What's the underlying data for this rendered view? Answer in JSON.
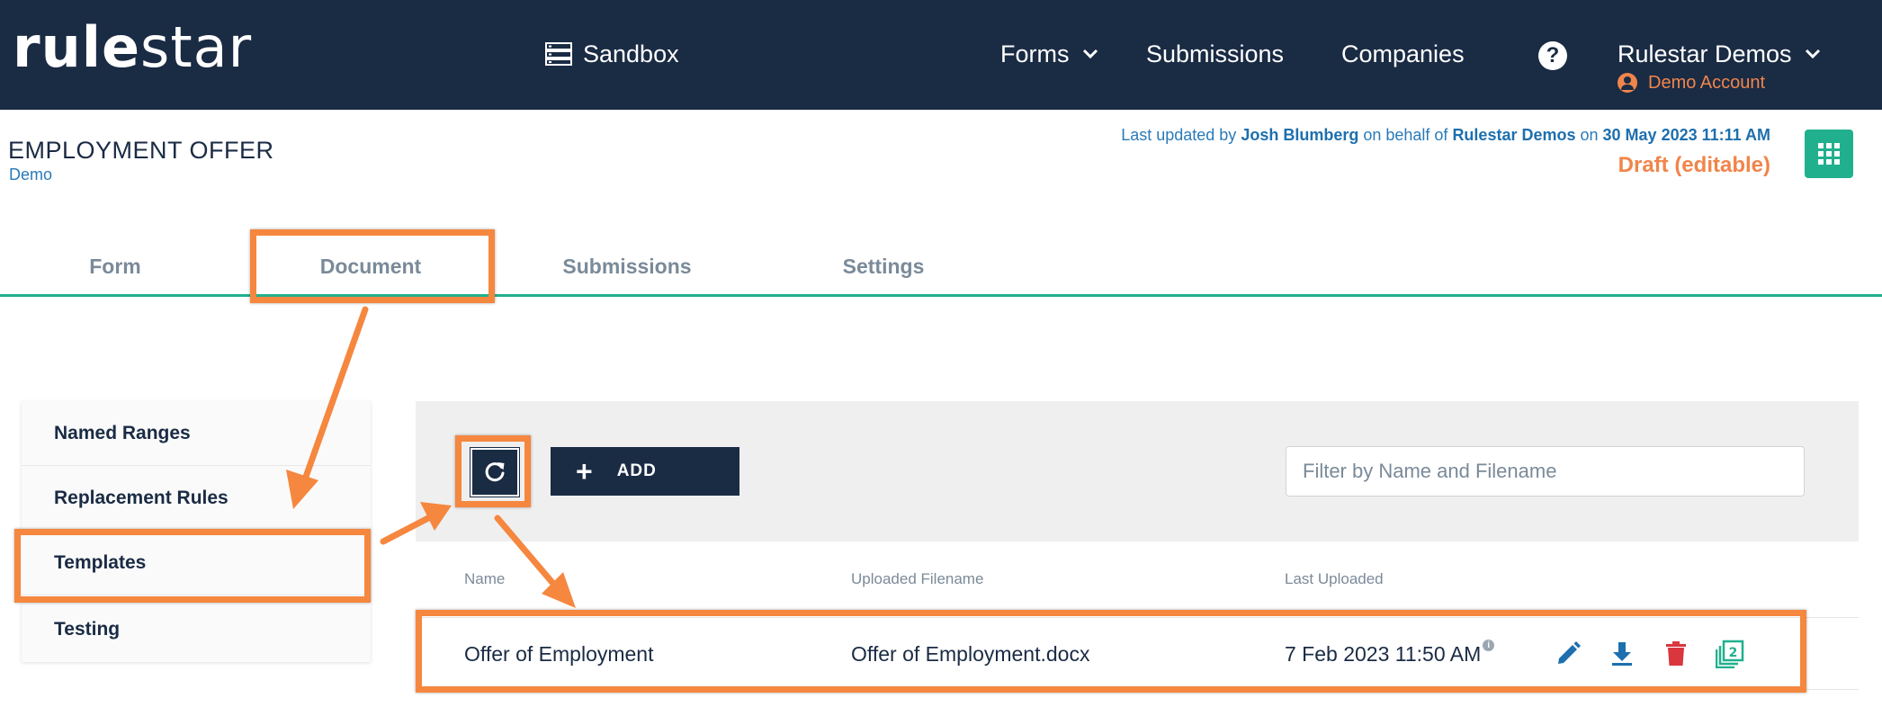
{
  "topbar": {
    "logo_bold": "rule",
    "logo_light": "star",
    "environment": "Sandbox",
    "nav": {
      "forms": "Forms",
      "submissions": "Submissions",
      "companies": "Companies"
    },
    "help": "?",
    "account_name": "Rulestar Demos",
    "account_sub": "Demo Account"
  },
  "header": {
    "title": "EMPLOYMENT OFFER",
    "subtitle": "Demo",
    "updated_prefix": "Last updated by ",
    "updated_user": "Josh Blumberg",
    "updated_middle": " on behalf of ",
    "updated_company": "Rulestar Demos",
    "updated_on": " on ",
    "updated_date": "30 May 2023 11:11 AM",
    "status": "Draft (editable)"
  },
  "tabs": [
    {
      "label": "Form"
    },
    {
      "label": "Document"
    },
    {
      "label": "Submissions"
    },
    {
      "label": "Settings"
    }
  ],
  "side_menu": [
    {
      "label": "Named Ranges"
    },
    {
      "label": "Replacement Rules"
    },
    {
      "label": "Templates"
    },
    {
      "label": "Testing"
    }
  ],
  "toolbar": {
    "add_label": "ADD",
    "filter_placeholder": "Filter by Name and Filename"
  },
  "table": {
    "columns": [
      "Name",
      "Uploaded Filename",
      "Last Uploaded"
    ],
    "rows": [
      {
        "name": "Offer of Employment",
        "filename": "Offer of Employment.docx",
        "last_uploaded": "7 Feb 2023 11:50 AM",
        "info": "i"
      }
    ]
  },
  "colors": {
    "topbar": "#1a2b44",
    "accent_green": "#21b08e",
    "accent_orange": "#f0854b",
    "link_blue": "#2a7ab8",
    "highlight": "#f5873f",
    "delete_red": "#d9363e"
  }
}
